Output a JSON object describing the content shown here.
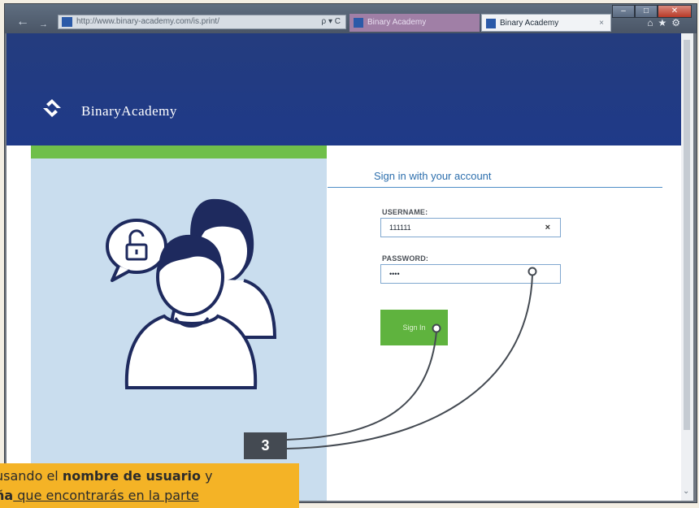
{
  "browser": {
    "address_url": "http://www.binary-academy.com/is.print/",
    "address_tools": "ρ ▾ C",
    "tabs": [
      {
        "label": "Binary Academy",
        "active": false
      },
      {
        "label": "Binary Academy",
        "active": true
      }
    ],
    "tab_close": "×",
    "window_controls": [
      "–",
      "□",
      "✕"
    ],
    "toolbar_icons": [
      "home-icon",
      "star-icon",
      "gear-icon"
    ]
  },
  "page": {
    "brand": "BinaryAcademy",
    "signin_title": "Sign in with your account",
    "username_label": "USERNAME:",
    "username_value": "111111",
    "clear_symbol": "×",
    "password_label": "PASSWORD:",
    "password_value": "••••",
    "signin_button": "Sign In"
  },
  "annotation": {
    "step_number": "3",
    "note_prefix": "usando el ",
    "note_bold1": "nombre de usuario",
    "note_mid": " y",
    "note_line2_bold": "ña",
    "note_line2_rest": " que encontrarás en la parte"
  },
  "colors": {
    "header_blue": "#1f3a88",
    "accent_green": "#6fbf4a",
    "panel_blue": "#c9ddee",
    "note_yellow": "#f4b326",
    "callout_gray": "#444a52"
  }
}
